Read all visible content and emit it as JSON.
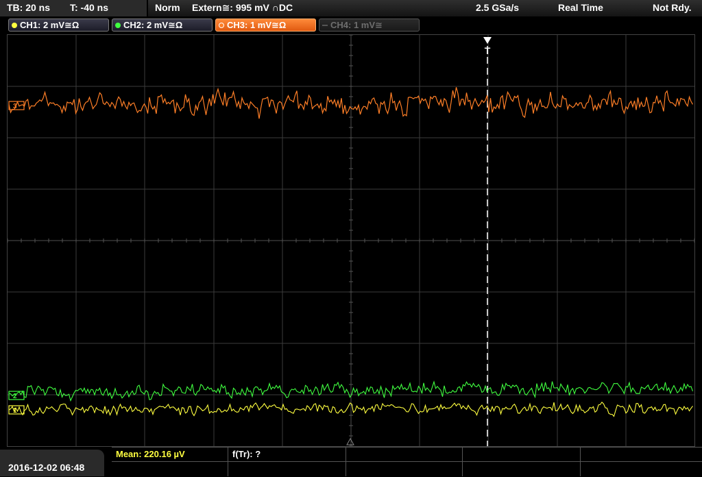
{
  "header": {
    "timebase": "TB: 20 ns",
    "trigger_time": "T: -40 ns",
    "mode": "Norm",
    "trigger_source": "Extern≅: 995 mV ∩DC",
    "sample_rate": "2.5 GSa/s",
    "acq_mode": "Real Time",
    "status": "Not Rdy."
  },
  "channels": [
    {
      "label": "CH1: 2 mV≅Ω",
      "color": "#ffff40",
      "state": "on"
    },
    {
      "label": "CH2: 2 mV≅Ω",
      "color": "#40ff40",
      "state": "on"
    },
    {
      "label": "CH3: 1 mV≅Ω",
      "color": "#ff7f27",
      "state": "active"
    },
    {
      "label": "CH4: 1 mV≅",
      "color": "#6e6e6e",
      "state": "off"
    }
  ],
  "markers": {
    "trigger": "T",
    "ch1": "1",
    "ch2": "2",
    "ch3": "3"
  },
  "measurement": {
    "mean": "Mean: 220.16 µV",
    "ftr": "f(Tr): ?"
  },
  "footer": {
    "datetime": "2016-12-02 06:48"
  },
  "colors": {
    "ch1": "#ffff40",
    "ch2": "#40ff40",
    "ch3": "#ff7f27",
    "grid": "#3c3c3c",
    "trigger_line": "#ffffff"
  }
}
